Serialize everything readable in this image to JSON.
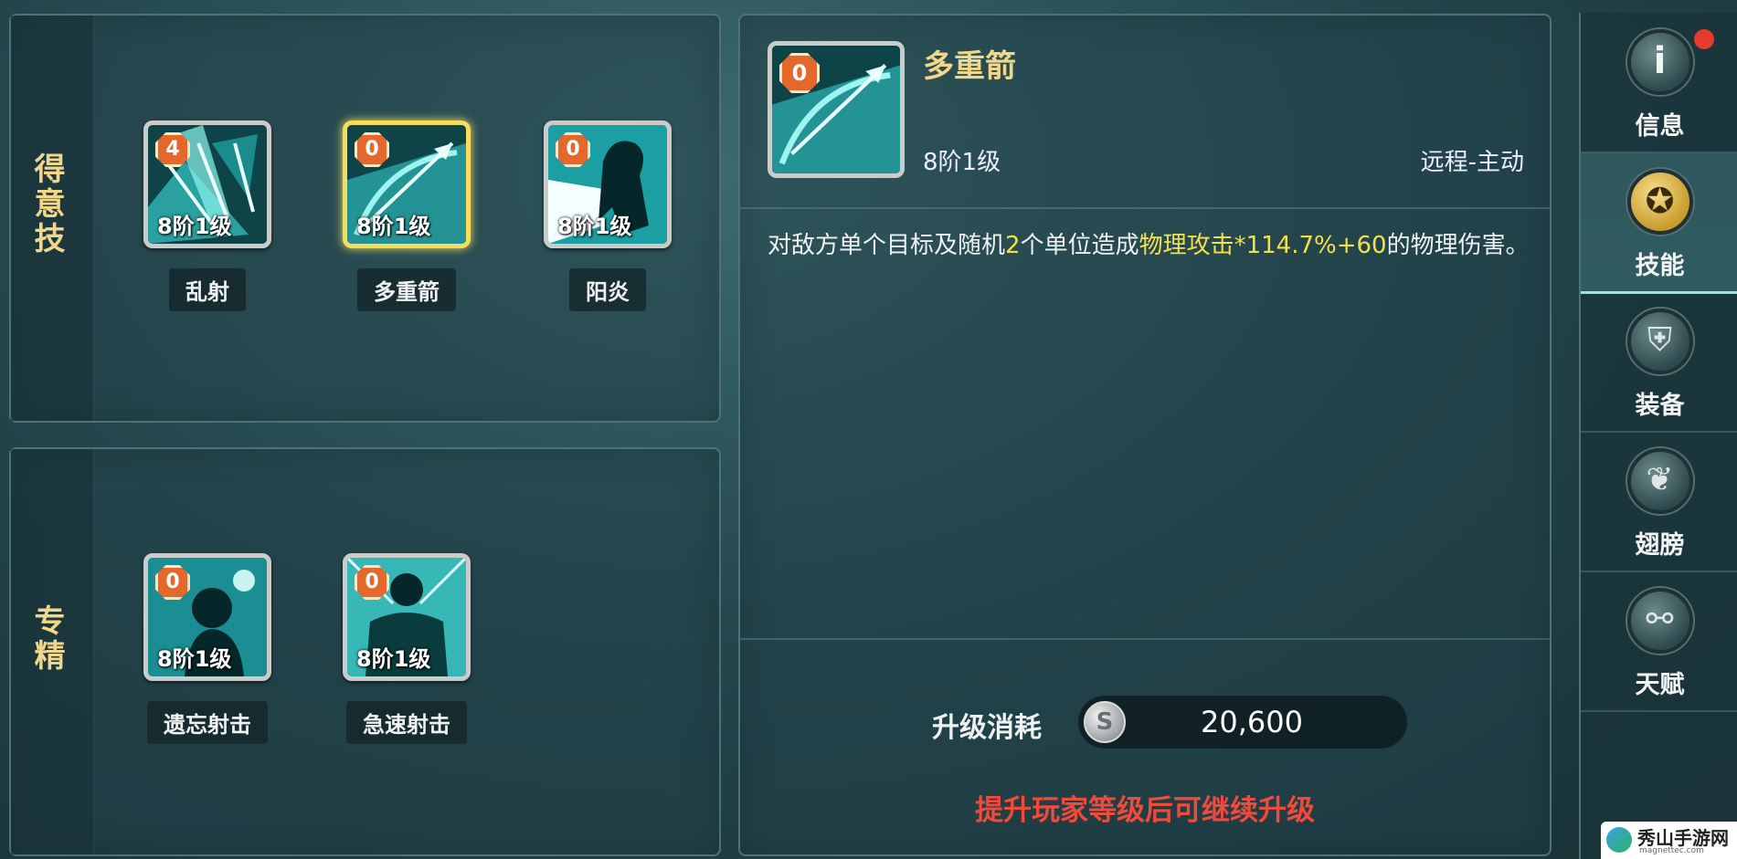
{
  "favorite_section": {
    "label": "得意技",
    "skills": [
      {
        "name": "乱射",
        "level": "8阶1级",
        "badge": "4"
      },
      {
        "name": "多重箭",
        "level": "8阶1级",
        "badge": "0",
        "selected": true
      },
      {
        "name": "阳炎",
        "level": "8阶1级",
        "badge": "0"
      }
    ]
  },
  "specialty_section": {
    "label": "专精",
    "skills": [
      {
        "name": "遗忘射击",
        "level": "8阶1级",
        "badge": "0"
      },
      {
        "name": "急速射击",
        "level": "8阶1级",
        "badge": "0"
      }
    ]
  },
  "detail": {
    "badge": "0",
    "title": "多重箭",
    "level": "8阶1级",
    "type": "远程-主动",
    "desc_part1": "对敌方单个目标及随机",
    "desc_num": "2",
    "desc_part2": "个单位造成",
    "desc_highlight": "物理攻击*114.7%+60",
    "desc_part3": "的物理伤害。",
    "cost_label": "升级消耗",
    "coin_symbol": "S",
    "cost_value": "20,600",
    "warning": "提升玩家等级后可继续升级"
  },
  "nav": {
    "items": [
      {
        "label": "信息",
        "icon": "info-icon",
        "glyph": "i"
      },
      {
        "label": "技能",
        "icon": "skill-icon",
        "glyph": "✪"
      },
      {
        "label": "装备",
        "icon": "armor-icon",
        "glyph": "⛨"
      },
      {
        "label": "翅膀",
        "icon": "wing-icon",
        "glyph": "❦"
      },
      {
        "label": "天赋",
        "icon": "share-icon",
        "glyph": "⚯"
      }
    ],
    "active_index": 1
  },
  "watermark": {
    "name": "秀山手游网",
    "url": "magnettec.com"
  },
  "colors": {
    "gold": "#f2d68a",
    "highlight": "#f3e04a",
    "warning": "#ef4a3c",
    "badge": "#e4682c"
  }
}
